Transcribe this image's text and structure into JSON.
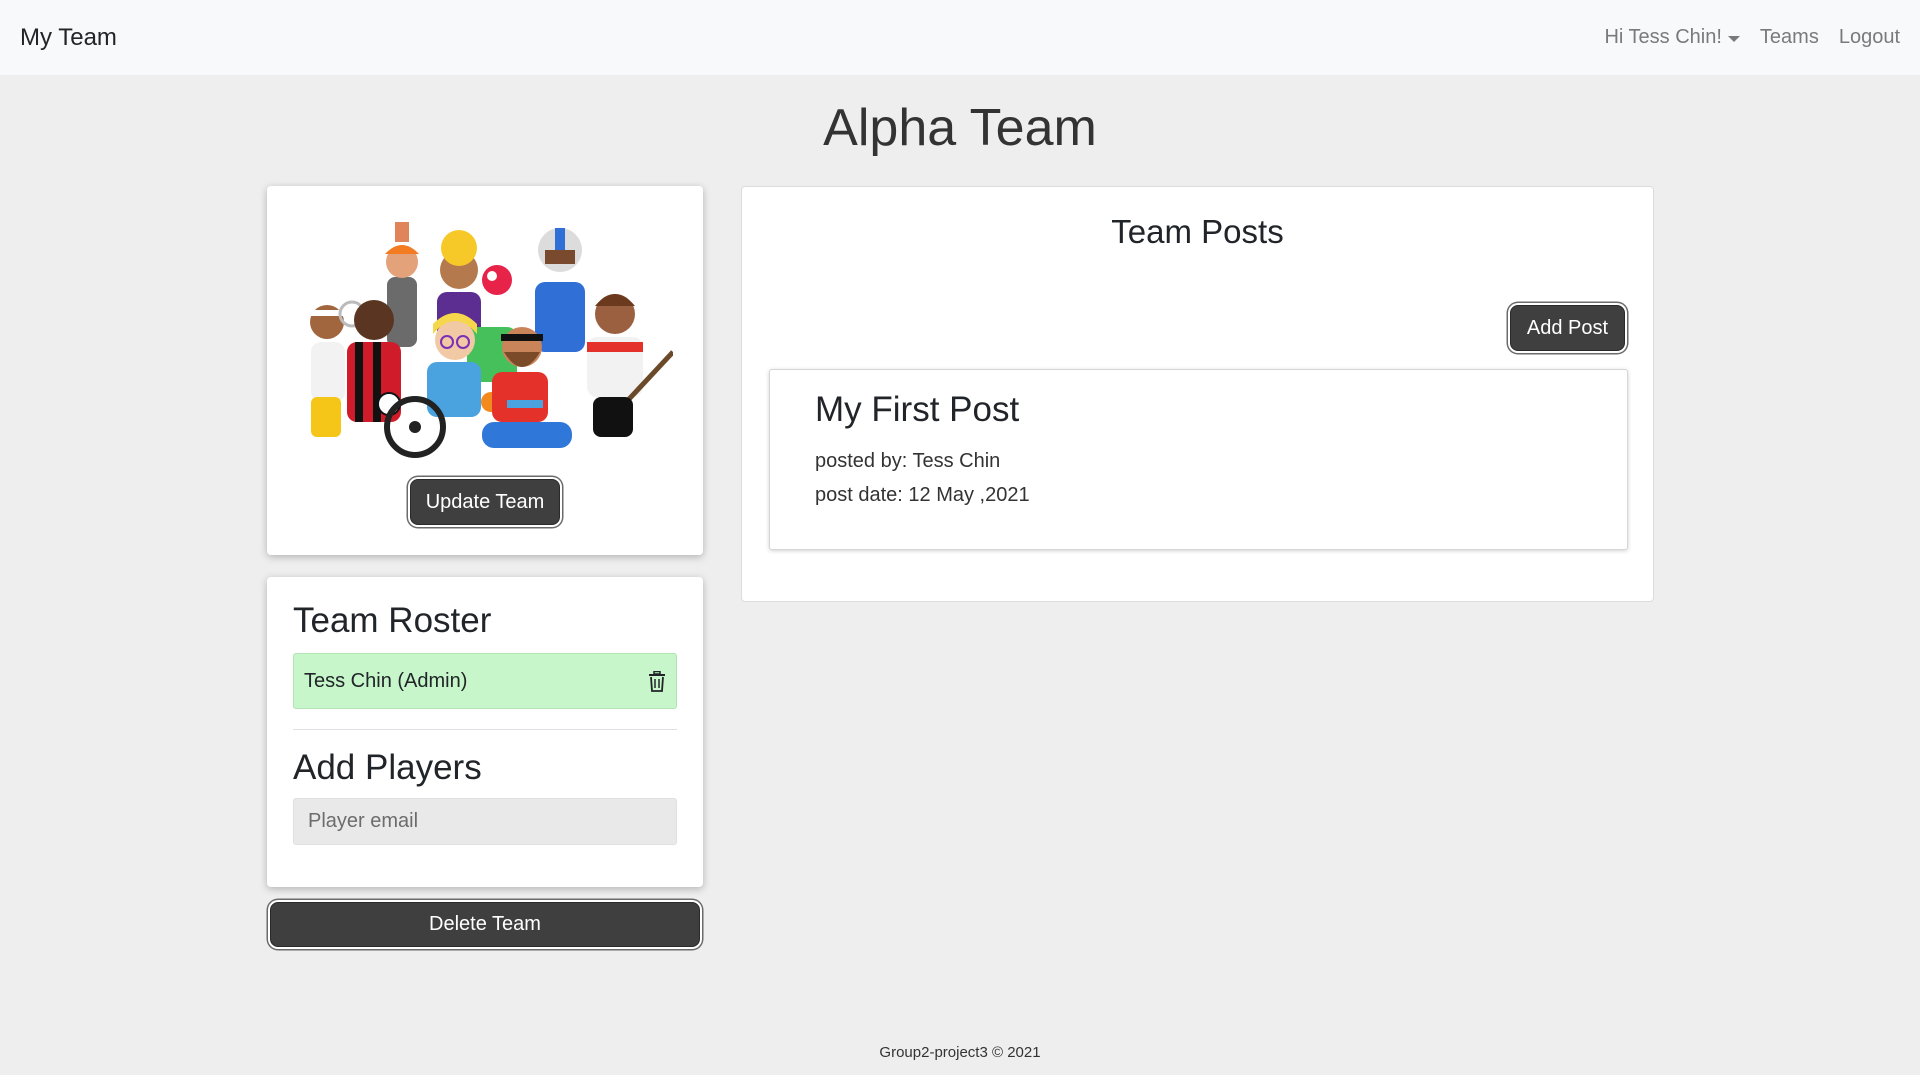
{
  "navbar": {
    "brand": "My Team",
    "user_menu_label": "Hi Tess Chin!",
    "teams_label": "Teams",
    "logout_label": "Logout"
  },
  "page_title": "Alpha Team",
  "team_card": {
    "update_button_label": "Update Team"
  },
  "roster": {
    "heading": "Team Roster",
    "members": [
      {
        "name": "Tess Chin (Admin)"
      }
    ],
    "add_heading": "Add Players",
    "email_placeholder": "Player email"
  },
  "delete_button_label": "Delete Team",
  "posts": {
    "heading": "Team Posts",
    "add_button_label": "Add Post",
    "items": [
      {
        "title": "My First Post",
        "posted_by": "posted by: Tess Chin",
        "post_date": "post date: 12 May ,2021"
      }
    ]
  },
  "footer": "Group2-project3 © 2021",
  "colors": {
    "navbar_bg": "#f8f9fa",
    "page_bg": "#eeeeee",
    "button_dark": "#3f3f3f",
    "roster_item_bg": "#c6f6c9"
  }
}
